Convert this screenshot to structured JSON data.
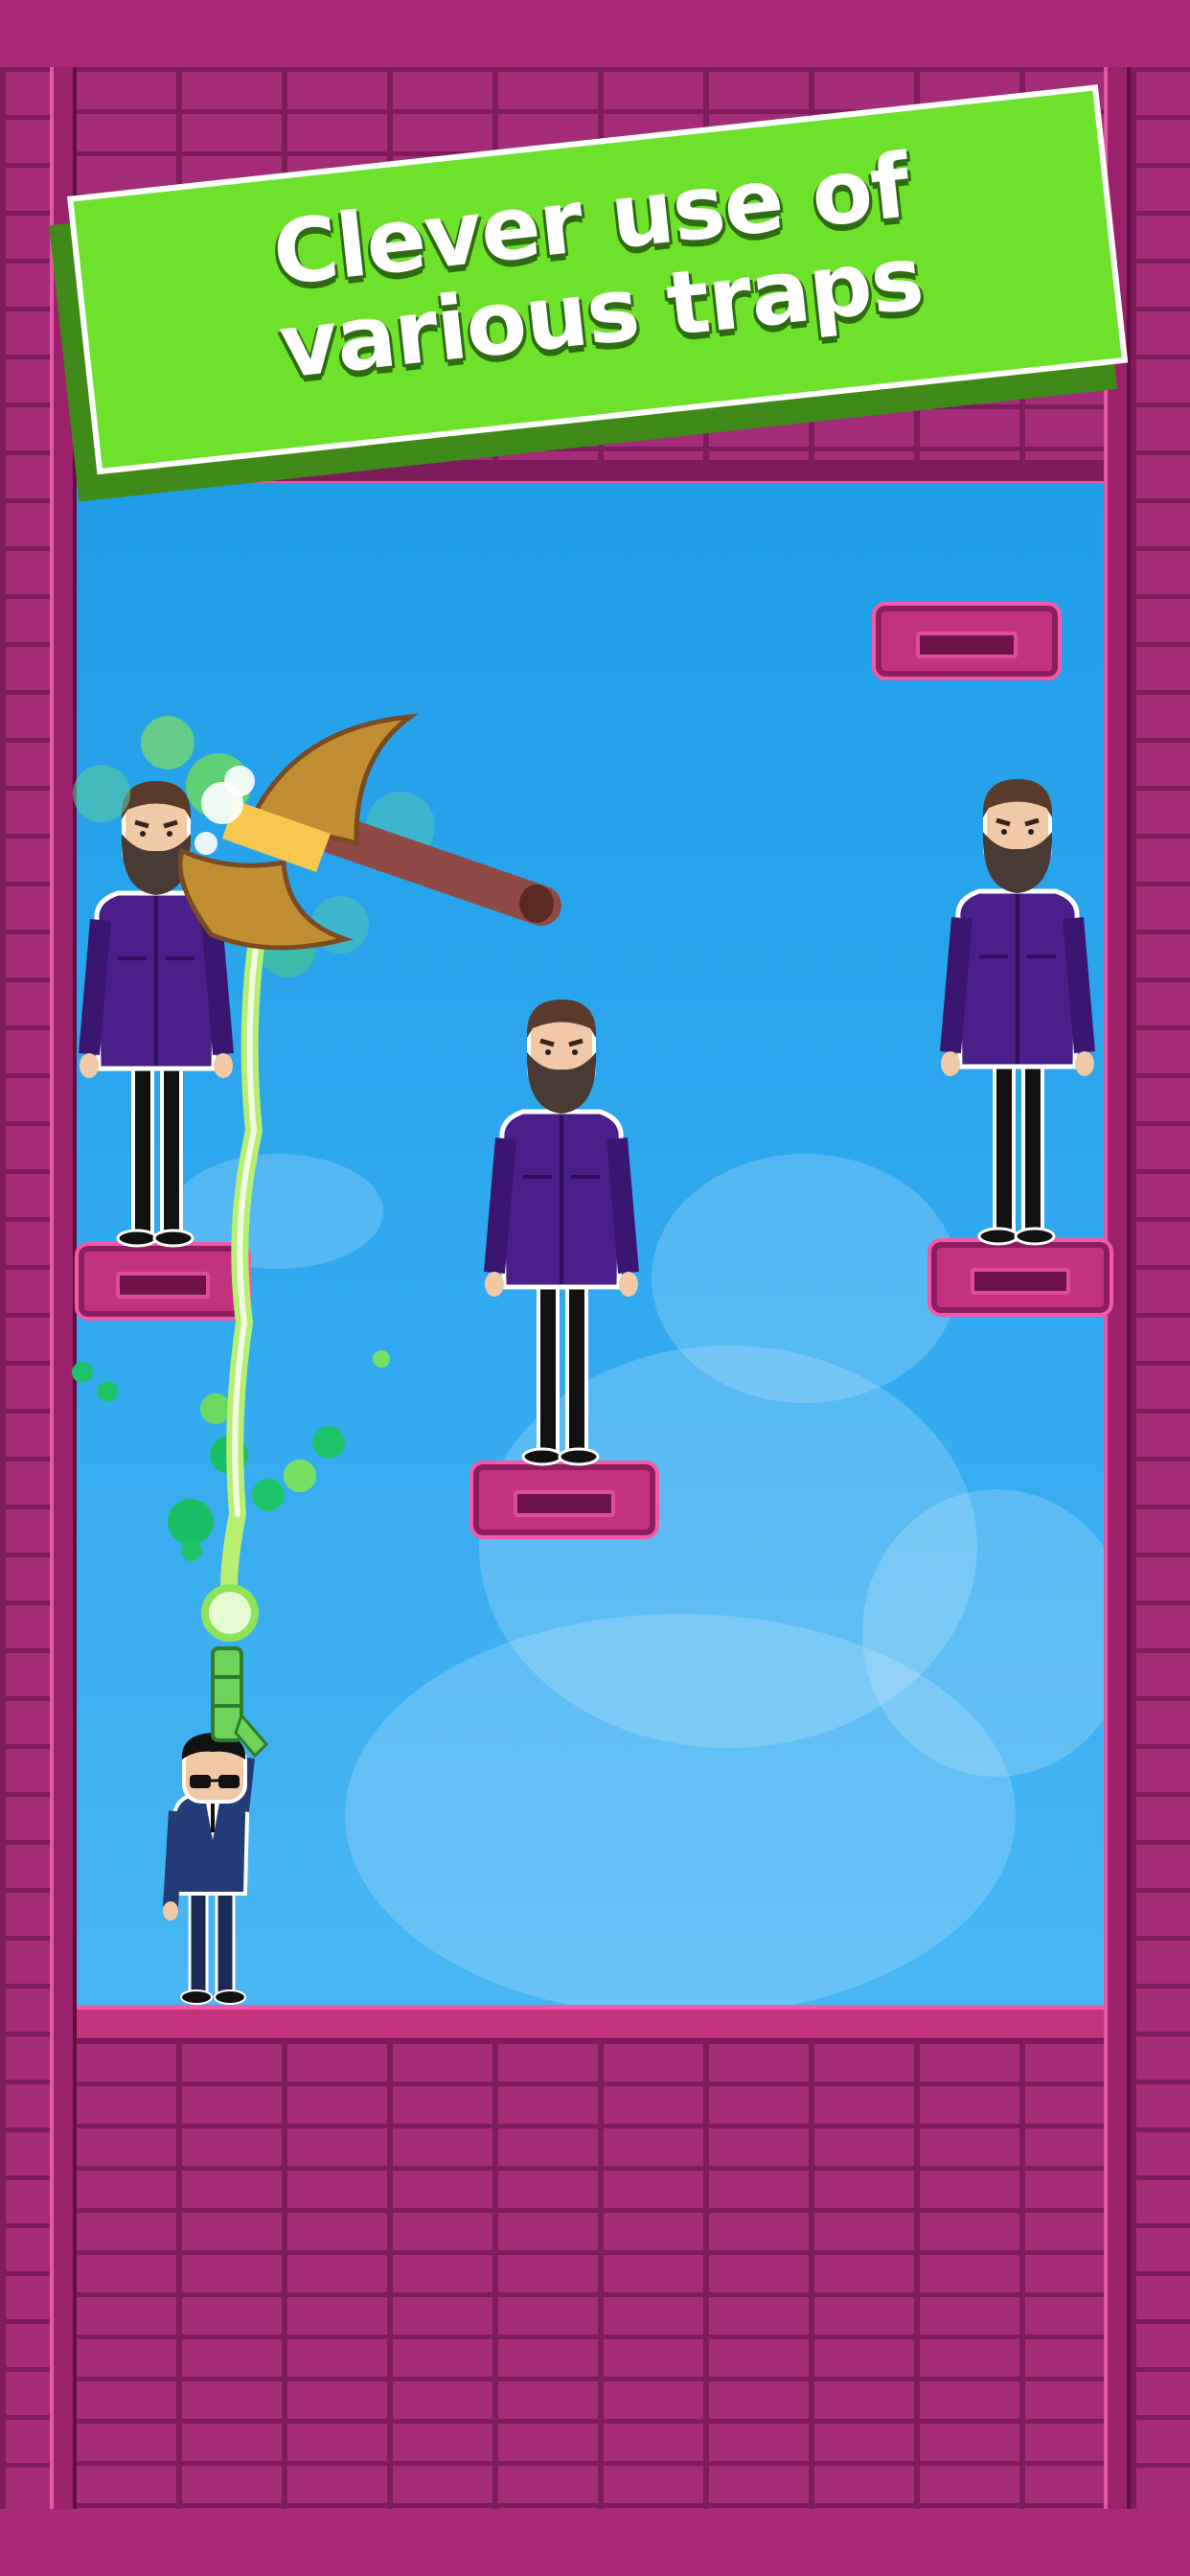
{
  "banner": {
    "line1": "Clever use of",
    "line2": "various traps",
    "color": "#6ee22b"
  },
  "scene": {
    "sky_color": "#31aaf0",
    "brick_color": "#a52c79",
    "platform_color": "#c2327f",
    "player": {
      "name": "agent-in-suit",
      "icon": "green-grenade-launcher"
    },
    "enemies": [
      "bearded-thug",
      "bearded-thug",
      "bearded-thug"
    ],
    "trap": "golden-double-axe"
  }
}
